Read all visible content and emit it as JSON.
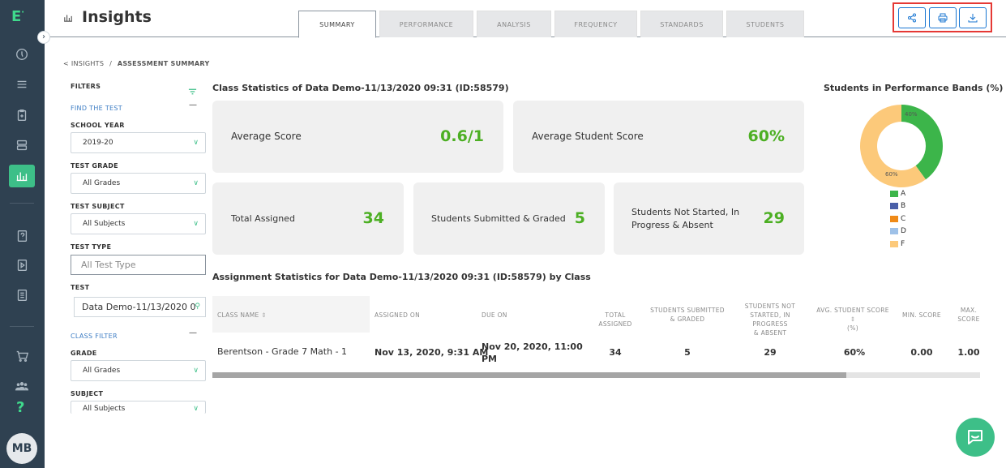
{
  "sidebar": {
    "logo": "E",
    "logo_dot": "·",
    "help": "?",
    "avatar_initials": "MB",
    "icons": [
      "clock-icon",
      "list-icon",
      "clipboard-icon",
      "stack-icon",
      "chart-icon",
      "doc-question-icon",
      "doc-play-icon",
      "doc-list-icon",
      "cart-icon",
      "users-icon"
    ]
  },
  "header": {
    "title": "Insights",
    "tabs": [
      {
        "label": "SUMMARY",
        "active": true
      },
      {
        "label": "PERFORMANCE",
        "active": false
      },
      {
        "label": "ANALYSIS",
        "active": false
      },
      {
        "label": "FREQUENCY",
        "active": false
      },
      {
        "label": "STANDARDS",
        "active": false
      },
      {
        "label": "STUDENTS",
        "active": false
      }
    ],
    "actions": [
      "share-icon",
      "print-icon",
      "download-icon"
    ]
  },
  "breadcrumb": {
    "back": "< INSIGHTS",
    "sep": "/",
    "current": "ASSESSMENT SUMMARY"
  },
  "filters": {
    "title": "FILTERS",
    "find_test": "FIND THE TEST",
    "school_year_label": "SCHOOL YEAR",
    "school_year_value": "2019-20",
    "test_grade_label": "TEST GRADE",
    "test_grade_value": "All Grades",
    "test_subject_label": "TEST SUBJECT",
    "test_subject_value": "All Subjects",
    "test_type_label": "TEST TYPE",
    "test_type_placeholder": "All Test Type",
    "test_label": "TEST",
    "test_value": "Data Demo-11/13/2020 0",
    "class_filter": "CLASS FILTER",
    "grade_label": "GRADE",
    "grade_value": "All Grades",
    "subject_label": "SUBJECT",
    "subject_value": "All Subjects"
  },
  "stats": {
    "title": "Class Statistics of Data Demo-11/13/2020 09:31 (ID:58579)",
    "average_score_label": "Average Score",
    "average_score_value": "0.6/1",
    "average_student_score_label": "Average Student Score",
    "average_student_score_value": "60%",
    "total_assigned_label": "Total Assigned",
    "total_assigned_value": "34",
    "submitted_label": "Students Submitted & Graded",
    "submitted_value": "5",
    "not_started_label_1": "Students Not Started, In",
    "not_started_label_2": "Progress & Absent",
    "not_started_value": "29"
  },
  "chart_data": {
    "type": "pie",
    "title": "Students in Performance Bands (%)",
    "categories": [
      "A",
      "B",
      "C",
      "D",
      "F"
    ],
    "values": [
      40,
      0,
      0,
      0,
      60
    ],
    "colors": [
      "#3cb54a",
      "#4a5fa8",
      "#ef8a17",
      "#9ec1e8",
      "#fcc97a"
    ],
    "data_labels": [
      "40%",
      "60%"
    ],
    "donut": true,
    "legend": "bottom"
  },
  "assignment": {
    "title": "Assignment Statistics for Data Demo-11/13/2020 09:31 (ID:58579) by Class",
    "headers": {
      "class_name": "CLASS NAME",
      "assigned_on": "ASSIGNED ON",
      "due_on": "DUE ON",
      "total_assigned": "TOTAL ASSIGNED",
      "submitted_1": "STUDENTS SUBMITTED",
      "submitted_2": "& GRADED",
      "not_started_1": "STUDENTS NOT",
      "not_started_2": "STARTED, IN PROGRESS",
      "not_started_3": "& ABSENT",
      "avg_1": "AVG. STUDENT SCORE",
      "avg_2": "(%)",
      "min": "MIN. SCORE",
      "max_1": "MAX.",
      "max_2": "SCORE"
    },
    "row": {
      "class_name": "Berentson - Grade 7 Math - 1",
      "assigned_on": "Nov 13, 2020, 9:31 AM",
      "due_on_1": "Nov 20, 2020, 11:00",
      "due_on_2": "PM",
      "total_assigned": "34",
      "submitted": "5",
      "not_started": "29",
      "avg": "60%",
      "min": "0.00",
      "max": "1.00"
    }
  }
}
